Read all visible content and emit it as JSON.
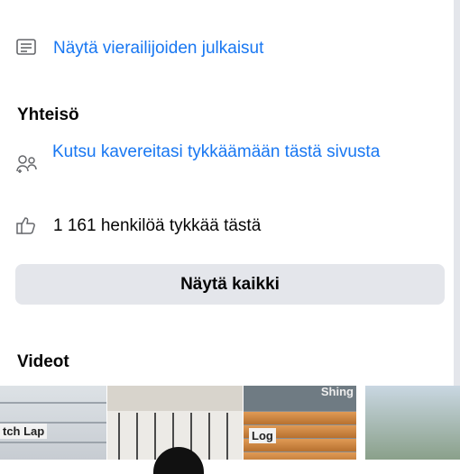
{
  "visitor_posts": {
    "label": "Näytä vierailijoiden julkaisut",
    "icon": "posts-icon"
  },
  "community": {
    "title": "Yhteisö",
    "invite_label": "Kutsu kavereitasi tykkäämään tästä sivusta",
    "likes_text": "1 161 henkilöä tykkää tästä",
    "see_all_button": "Näytä kaikki"
  },
  "videos": {
    "title": "Videot",
    "thumbnails": [
      {
        "caption": "tch Lap"
      },
      {
        "caption": ""
      },
      {
        "caption": "Log",
        "top_caption": "Shing"
      },
      {
        "caption": ""
      }
    ]
  },
  "colors": {
    "link": "#1877f2",
    "button_bg": "#e4e6eb",
    "icon": "#65676b"
  }
}
